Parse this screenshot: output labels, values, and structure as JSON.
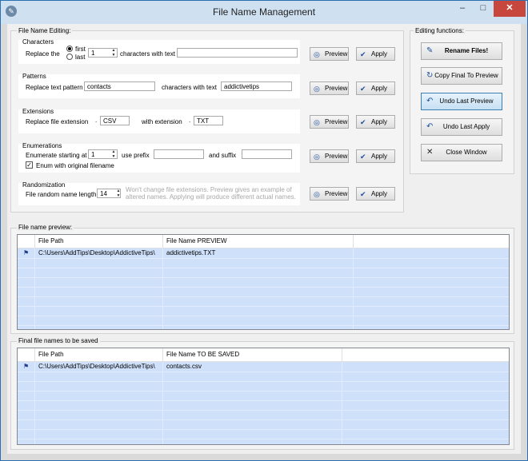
{
  "window": {
    "title": "File Name Management",
    "min": "–",
    "max": "□",
    "close": "✕"
  },
  "editing": {
    "label": "File Name Editing:",
    "characters": {
      "label": "Characters",
      "replace_the": "Replace the",
      "first": "first",
      "last": "last",
      "count": "1",
      "with_text": "characters with text",
      "text_value": ""
    },
    "patterns": {
      "label": "Patterns",
      "replace_text_pattern": "Replace text pattern",
      "pattern_value": "contacts",
      "with_text": "characters with text",
      "replacement_value": "addictivetips"
    },
    "extensions": {
      "label": "Extensions",
      "replace_ext": "Replace file extension",
      "dot": ".",
      "from_value": "CSV",
      "with_ext": "with extension",
      "to_value": "TXT"
    },
    "enumerations": {
      "label": "Enumerations",
      "start_label": "Enumerate starting at",
      "start_value": "1",
      "prefix_label": "use prefix",
      "prefix_value": "",
      "suffix_label": "and suffix",
      "suffix_value": "",
      "enum_original": "Enum with original filename"
    },
    "randomization": {
      "label": "Randomization",
      "length_label": "File random name length",
      "length_value": "14",
      "note": "Won't change file extensions. Preview gives an example of altered names. Applying will produce different actual names."
    },
    "preview_label": "Preview",
    "apply_label": "Apply"
  },
  "functions": {
    "label": "Editing functions:",
    "rename": "Rename Files!",
    "copy_final": "Copy Final To Preview",
    "undo_preview": "Undo Last Preview",
    "undo_apply": "Undo Last Apply",
    "close_window": "Close Window"
  },
  "preview_list": {
    "label": "File name preview:",
    "col_path": "File Path",
    "col_name": "File Name PREVIEW",
    "rows": [
      {
        "path": "C:\\Users\\AddTips\\Desktop\\AddictiveTips\\",
        "name": "addictivetips.TXT"
      }
    ]
  },
  "final_list": {
    "label": "Final file names to be saved",
    "col_path": "File Path",
    "col_name": "File Name TO BE SAVED",
    "rows": [
      {
        "path": "C:\\Users\\AddTips\\Desktop\\AddictiveTips\\",
        "name": "contacts.csv"
      }
    ]
  },
  "colors": {
    "accent": "#1d4f9c",
    "close_button": "#c7463d",
    "list_row": "#cfe0fb"
  }
}
